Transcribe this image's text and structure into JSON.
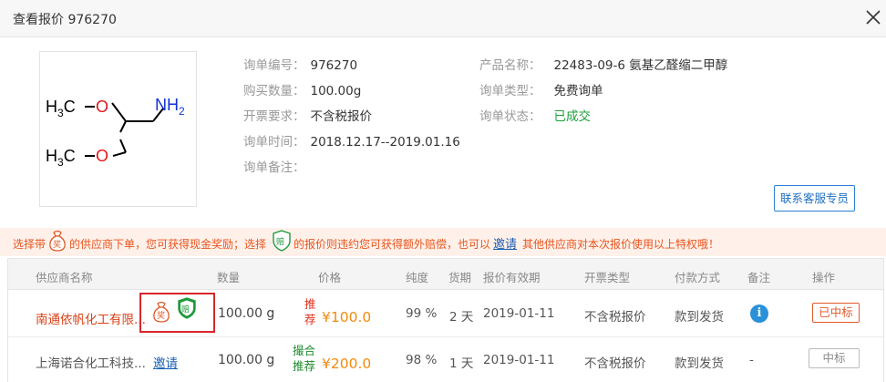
{
  "window": {
    "title": "查看报价 976270"
  },
  "structure": {
    "formula_labels": [
      "H",
      "3",
      "C",
      "O",
      "O",
      "H",
      "3",
      "C",
      "NH",
      "2"
    ]
  },
  "inquiry": {
    "left": [
      {
        "label": "询单编号：",
        "value": "976270"
      },
      {
        "label": "购买数量：",
        "value": "100.00g"
      },
      {
        "label": "开票要求：",
        "value": "不含税报价"
      },
      {
        "label": "询单时间：",
        "value": "2018.12.17--2019.01.16"
      },
      {
        "label": "询单备注：",
        "value": ""
      }
    ],
    "right": [
      {
        "label": "产品名称：",
        "value": "22483-09-6 氨基乙醛缩二甲醇"
      },
      {
        "label": "询单类型：",
        "value": "免费询单"
      },
      {
        "label": "询单状态：",
        "value": "已成交"
      }
    ]
  },
  "contact_button": "联系客服专员",
  "notice": {
    "part1": "选择带",
    "icon1_text": "奖",
    "part2": "的供应商下单，您可获得现金奖励；选择",
    "icon2_text": "赔",
    "part3": "的报价则违约您可获得额外赔偿，也可以",
    "link": "邀请",
    "part4": "其他供应商对本次报价使用以上特权哦！"
  },
  "table": {
    "headers": [
      "供应商名称",
      "数量",
      "价格",
      "纯度",
      "货期",
      "报价有效期",
      "开票类型",
      "付款方式",
      "备注",
      "操作"
    ],
    "rows": [
      {
        "supplier": "南通依帆化工有限...",
        "badges": [
          "奖",
          "赔"
        ],
        "quantity": "100.00 g",
        "tag": [
          "推",
          "荐"
        ],
        "price": "¥100.0",
        "purity": "99 %",
        "delivery": "2 天",
        "valid_until": "2019-01-11",
        "invoice": "不含税报价",
        "payment": "款到发货",
        "remark": "i",
        "action": "已中标"
      },
      {
        "supplier": "上海诺合化工科技...",
        "invite": "邀请",
        "quantity": "100.00 g",
        "tag": [
          "撮合",
          "推荐"
        ],
        "price": "¥200.0",
        "purity": "98 %",
        "delivery": "1 天",
        "valid_until": "2019-01-11",
        "invoice": "不含税报价",
        "payment": "款到发货",
        "remark": "-",
        "action": "中标"
      }
    ]
  },
  "colors": {
    "accent_blue": "#2a7fd4",
    "status_green": "#19a13b",
    "price_orange": "#f28b0c",
    "supplier_red": "#d94219",
    "notice_bg": "#fff1ea"
  }
}
